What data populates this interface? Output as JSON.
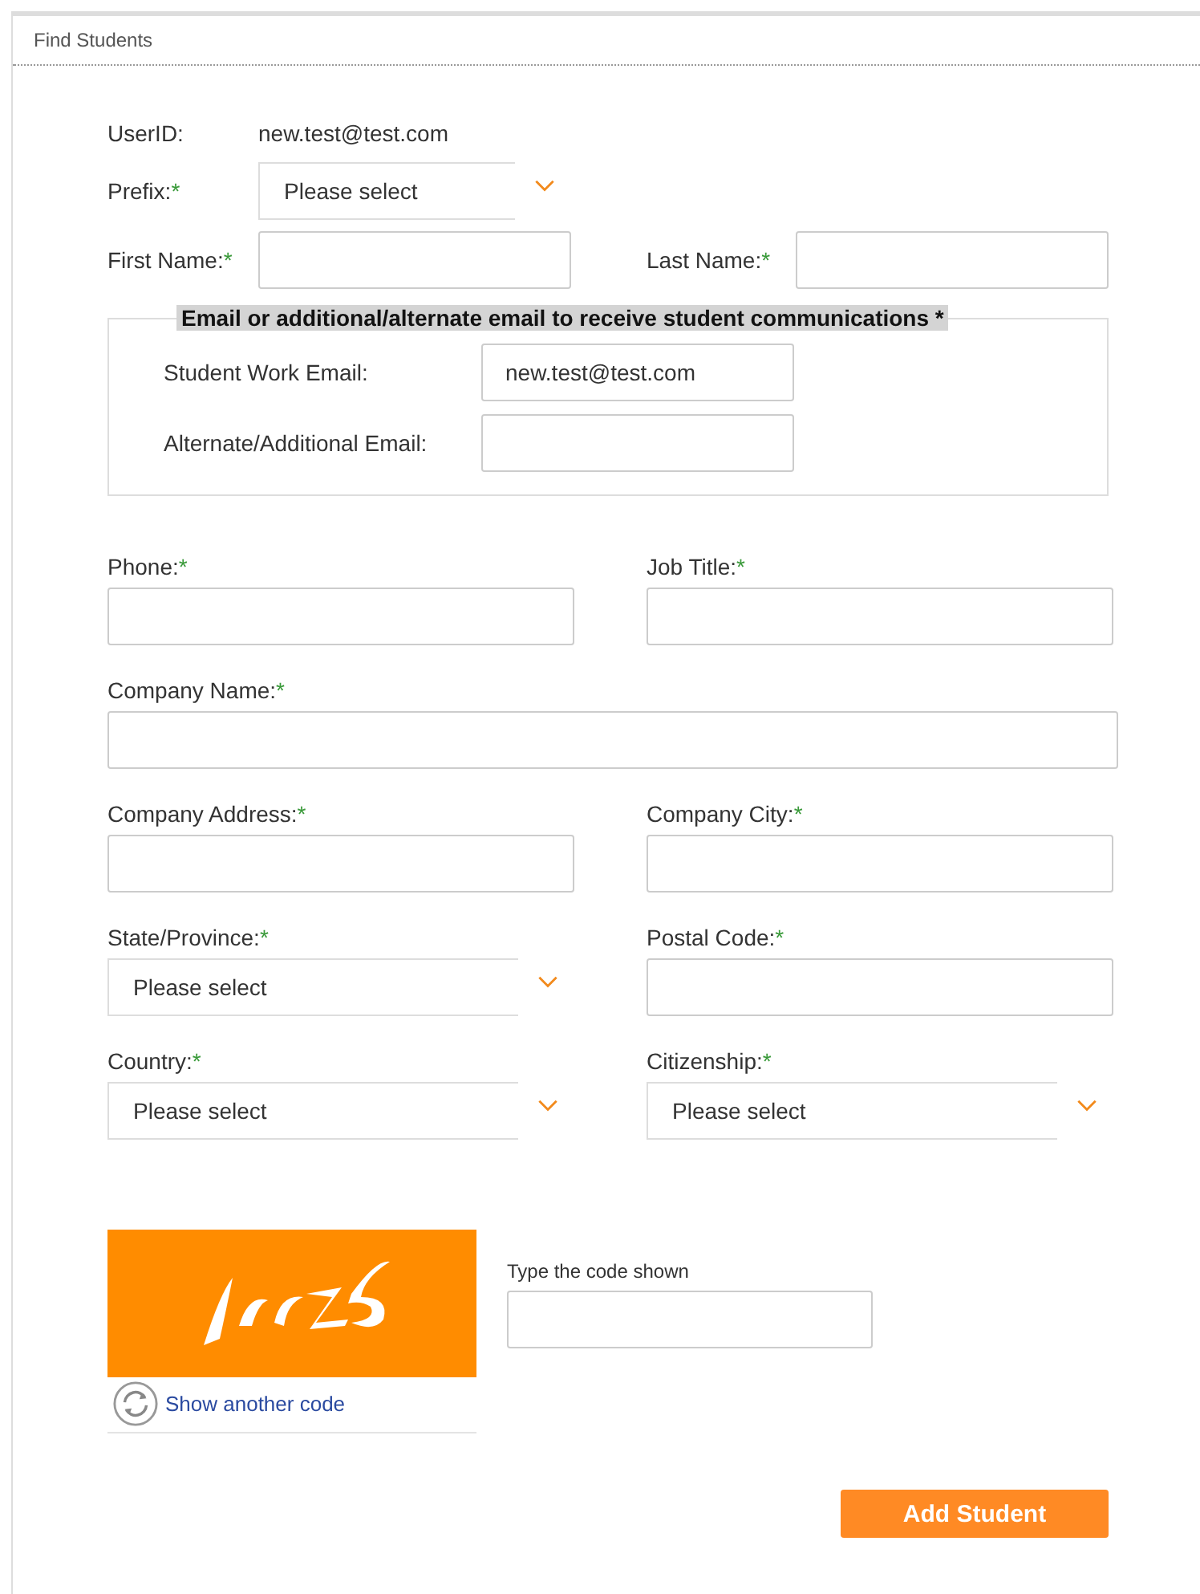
{
  "panel": {
    "title": "Find Students"
  },
  "user_id": {
    "label": "UserID:",
    "value": "new.test@test.com"
  },
  "prefix": {
    "label": "Prefix:",
    "required_mark": "*",
    "value": "Please select"
  },
  "first_name": {
    "label": "First Name:",
    "required_mark": "*"
  },
  "last_name": {
    "label": "Last Name:",
    "required_mark": "*"
  },
  "email_group": {
    "legend": "Email or additional/alternate email to receive student communications *",
    "fields": [
      {
        "label": "Student Work Email:",
        "value": "new.test@test.com"
      },
      {
        "label": "Alternate/Additional Email:"
      }
    ]
  },
  "fields": [
    {
      "kind": "text",
      "label": "Phone:",
      "required_mark": "*"
    },
    {
      "kind": "text",
      "label": "Job Title:",
      "required_mark": "*"
    },
    {
      "kind": "wide",
      "label": "Company Name:",
      "required_mark": "*"
    },
    {
      "kind": "text",
      "label": "Company Address:",
      "required_mark": "*"
    },
    {
      "kind": "text",
      "label": "Company City:",
      "required_mark": "*"
    },
    {
      "kind": "select",
      "label": "State/Province:",
      "required_mark": "*",
      "value": "Please select"
    },
    {
      "kind": "text",
      "label": "Postal Code:",
      "required_mark": "*"
    },
    {
      "kind": "select",
      "label": "Country:",
      "required_mark": "*",
      "value": "Please select"
    },
    {
      "kind": "select",
      "label": "Citizenship:",
      "required_mark": "*",
      "value": "Please select"
    }
  ],
  "captcha": {
    "kind": "picture",
    "link": "Show another code",
    "prompt": "Type the code shown"
  },
  "submit": "Add Student"
}
